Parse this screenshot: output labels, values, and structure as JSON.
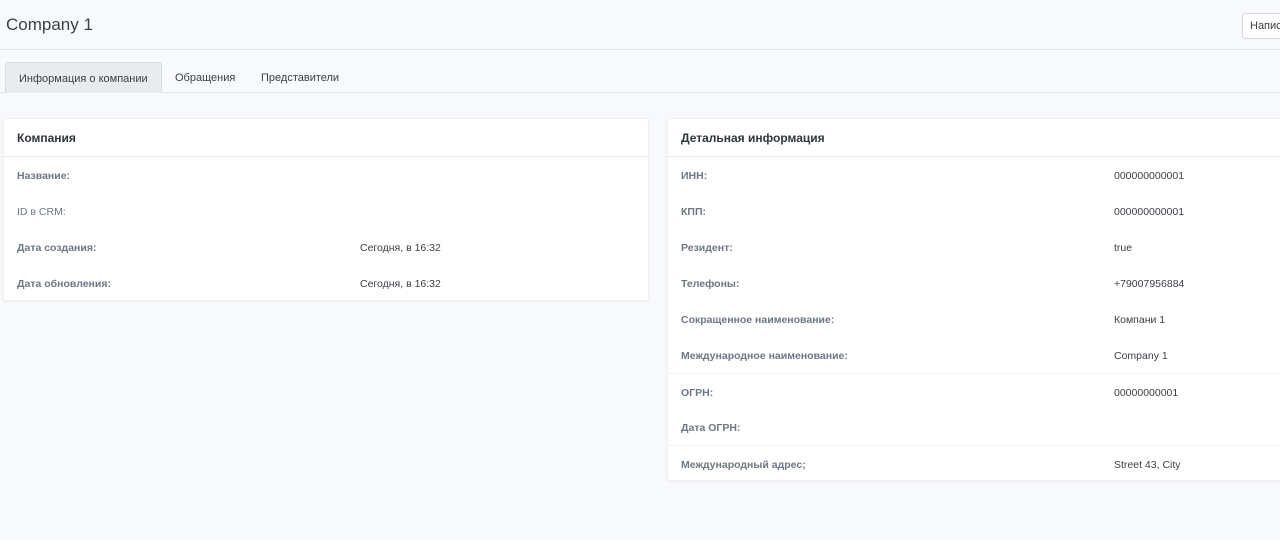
{
  "header": {
    "title": "Company 1",
    "write_button_label": "Написать"
  },
  "tabs": [
    {
      "label": "Информация о компании",
      "active": true
    },
    {
      "label": "Обращения",
      "active": false
    },
    {
      "label": "Представители",
      "active": false
    }
  ],
  "company_card": {
    "title": "Компания",
    "rows": [
      {
        "label": "Название:",
        "value": ""
      },
      {
        "label": "ID в CRM:",
        "value": ""
      },
      {
        "label": "Дата создания:",
        "value": "Сегодня, в 16:32"
      },
      {
        "label": "Дата обновления:",
        "value": "Сегодня, в 16:32"
      }
    ]
  },
  "details_card": {
    "title": "Детальная информация",
    "rows": [
      {
        "label": "ИНН:",
        "value": "000000000001"
      },
      {
        "label": "КПП:",
        "value": "000000000001"
      },
      {
        "label": "Резидент:",
        "value": "true"
      },
      {
        "label": "Телефоны:",
        "value": "+79007956884"
      },
      {
        "label": "Сокращенное наименование:",
        "value": "Компани 1"
      },
      {
        "label": "Международное наименование:",
        "value": "Company 1"
      },
      {
        "label": "ОГРН:",
        "value": "00000000001"
      },
      {
        "label": "Дата ОГРН:",
        "value": ""
      },
      {
        "label": "Международный адрес;",
        "value": "Street 43, City"
      }
    ]
  }
}
